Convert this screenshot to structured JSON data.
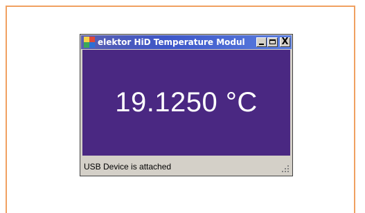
{
  "window": {
    "title": "elektor HiD Temperature Modul",
    "app_icon": "app-icon",
    "buttons": {
      "minimize": "minimize-icon",
      "maximize": "maximize-icon",
      "close_glyph": "X"
    }
  },
  "display": {
    "temperature": "19.1250 °C",
    "background_color": "#4a2882"
  },
  "statusbar": {
    "text": "USB Device is attached"
  }
}
